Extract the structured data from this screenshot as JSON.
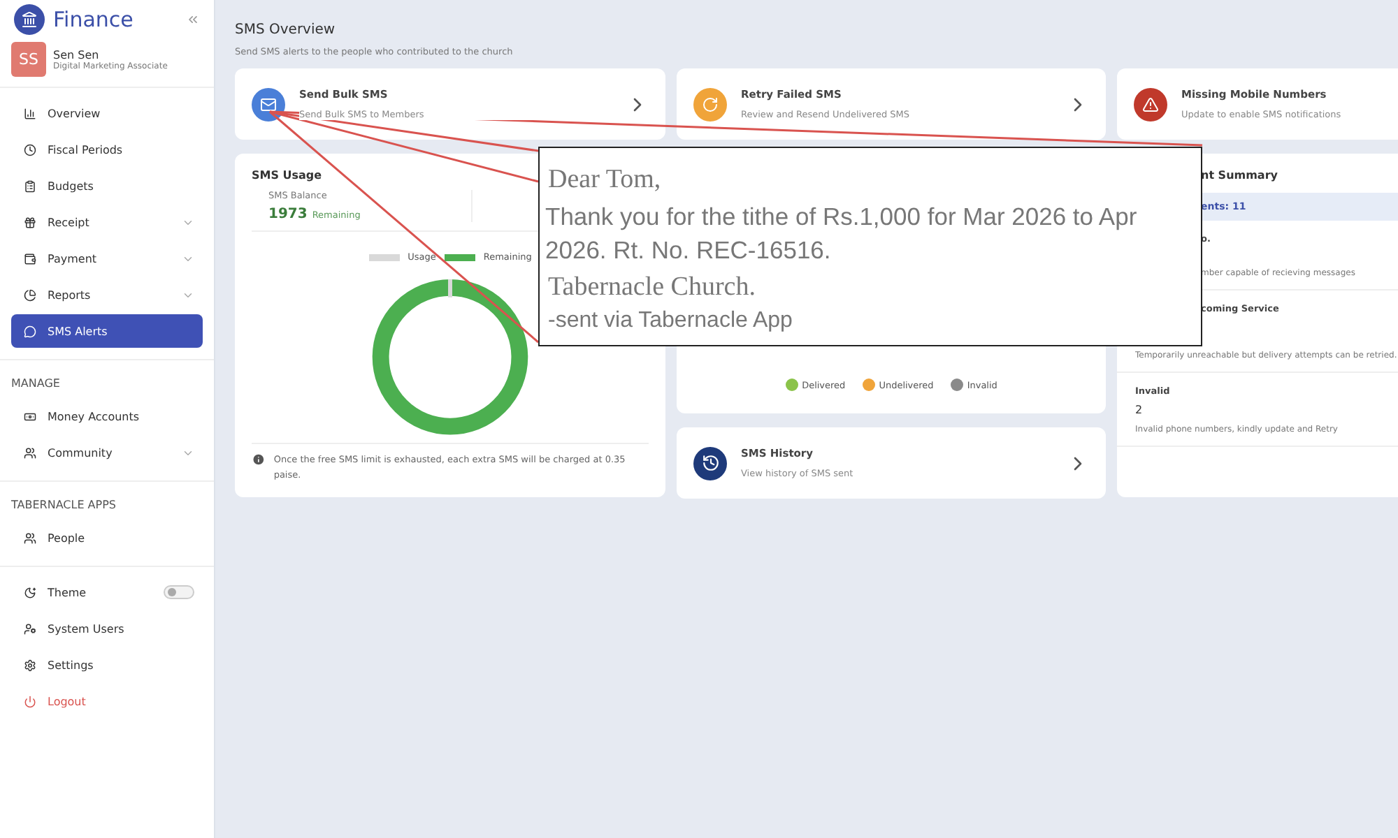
{
  "sidebar": {
    "brand": "Finance",
    "user": {
      "initials": "SS",
      "name": "Sen Sen",
      "role": "Digital Marketing Associate"
    },
    "sections": [
      {
        "items": [
          {
            "label": "Overview",
            "kind": "link",
            "selected": false
          },
          {
            "label": "Fiscal Periods",
            "kind": "link",
            "selected": false
          },
          {
            "label": "Budgets",
            "kind": "link",
            "selected": false
          },
          {
            "label": "Receipt",
            "kind": "group",
            "selected": false
          },
          {
            "label": "Payment",
            "kind": "group",
            "selected": false
          },
          {
            "label": "Reports",
            "kind": "group",
            "selected": false
          },
          {
            "label": "SMS Alerts",
            "kind": "link",
            "selected": true
          }
        ]
      },
      {
        "heading": "MANAGE",
        "items": [
          {
            "label": "Money Accounts",
            "kind": "link",
            "selected": false
          },
          {
            "label": "Community",
            "kind": "group",
            "selected": false
          }
        ]
      },
      {
        "heading": "TABERNACLE APPS",
        "items": [
          {
            "label": "People",
            "kind": "link",
            "selected": false
          }
        ]
      },
      {
        "items": [
          {
            "label": "Theme",
            "kind": "toggle",
            "on": false,
            "selected": false
          },
          {
            "label": "System Users",
            "kind": "link",
            "selected": false
          },
          {
            "label": "Settings",
            "kind": "link",
            "selected": false
          },
          {
            "label": "Logout",
            "kind": "danger",
            "selected": false
          }
        ]
      }
    ]
  },
  "page": {
    "title": "SMS Overview",
    "subtitle": "Send SMS alerts to the people who contributed to the church"
  },
  "actions": [
    {
      "title": "Send Bulk SMS",
      "description": "Send Bulk SMS to Members",
      "color": "#4a7fd8",
      "arrow": true
    },
    {
      "title": "Retry Failed SMS",
      "description": "Review and Resend Undelivered SMS",
      "color": "#f0a43a",
      "arrow": true
    },
    {
      "title": "Missing Mobile Numbers",
      "description": "Update to enable SMS notifications",
      "color": "#c0392b"
    }
  ],
  "usage": {
    "title": "SMS Usage",
    "balance_label": "SMS Balance",
    "balance": "1973",
    "balance_unit": "Remaining",
    "legend": [
      {
        "label": "Usage",
        "color": "#d9d9d9"
      },
      {
        "label": "Remaining",
        "color": "#4caf50"
      }
    ],
    "note": "Once the free SMS limit is exhausted, each extra SMS will be charged at 0.35 paise."
  },
  "delivery_legend": [
    {
      "label": "Delivered",
      "color": "#8bc34a"
    },
    {
      "label": "Undelivered",
      "color": "#f0a43a"
    },
    {
      "label": "Invalid",
      "color": "#8a8a8a"
    }
  ],
  "history": {
    "title": "SMS History",
    "description": "View history of SMS sent"
  },
  "summary": {
    "title": "nt Summary",
    "total": "ents: 11",
    "items": [
      {
        "label": "o.",
        "description": "mber capable of recieving messages"
      },
      {
        "label": "coming Service",
        "description": "Temporarily unreachable but delivery attempts can be retried."
      },
      {
        "label": "Invalid",
        "value": "2",
        "description": "Invalid phone numbers, kindly update and Retry"
      }
    ]
  },
  "message_preview": {
    "greeting": "Dear Tom,",
    "body": "Thank you for the tithe of Rs.1,000 for Mar 2026 to Apr 2026. Rt. No. REC-16516.",
    "signature": "Tabernacle Church.",
    "footer": "-sent via Tabernacle App"
  }
}
